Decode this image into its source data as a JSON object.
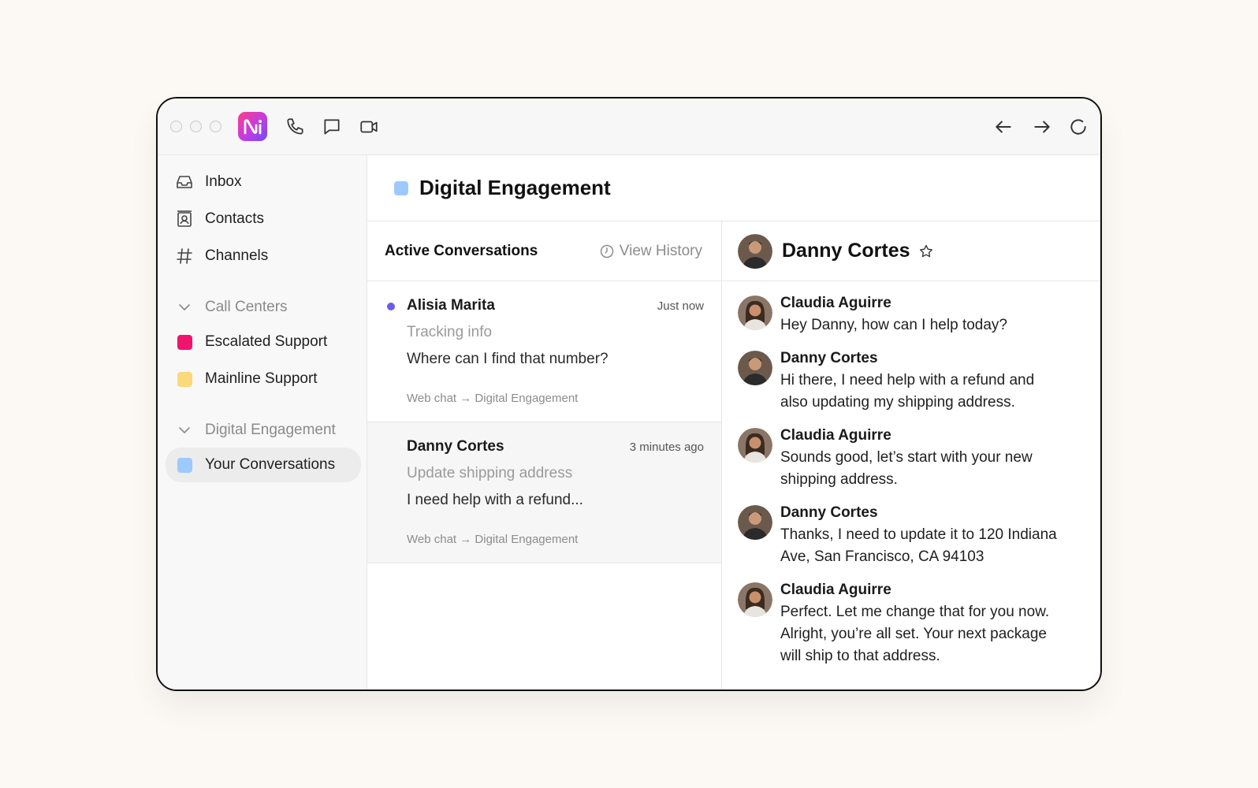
{
  "app": {
    "title": "Digital Engagement",
    "brand_color": "#c03de0"
  },
  "titlebar": {
    "icons": [
      "phone-icon",
      "chat-bubble-icon",
      "video-icon",
      "arrow-left-icon",
      "arrow-right-icon",
      "refresh-icon"
    ]
  },
  "sidebar": {
    "items": [
      {
        "label": "Inbox",
        "icon": "inbox-icon"
      },
      {
        "label": "Contacts",
        "icon": "contacts-icon"
      },
      {
        "label": "Channels",
        "icon": "hash-icon"
      }
    ],
    "sections": [
      {
        "label": "Call Centers",
        "items": [
          {
            "label": "Escalated Support",
            "color": "#f0146e"
          },
          {
            "label": "Mainline Support",
            "color": "#fbd97a"
          }
        ]
      },
      {
        "label": "Digital Engagement",
        "items": [
          {
            "label": "Your Conversations",
            "color": "#9ec9ff"
          }
        ]
      }
    ]
  },
  "main": {
    "title": "Digital Engagement",
    "color": "#9ec9ff"
  },
  "list": {
    "title": "Active Conversations",
    "history_label": "View History",
    "conversations": [
      {
        "name": "Alisia Marita",
        "time": "Just now",
        "subject": "Tracking info",
        "preview": "Where can I find that number?",
        "route": "Web chat → Digital Engagement",
        "unread": true
      },
      {
        "name": "Danny Cortes",
        "time": "3 minutes ago",
        "subject": "Update shipping address",
        "preview": "I need help with a refund...",
        "route": "Web chat → Digital Engagement",
        "unread": false
      }
    ]
  },
  "chat": {
    "contact": "Danny Cortes",
    "messages": [
      {
        "sender": "Claudia Aguirre",
        "text": "Hey Danny, how can I help today?"
      },
      {
        "sender": "Danny Cortes",
        "text": "Hi there, I need help with a refund and also updating my shipping address."
      },
      {
        "sender": "Claudia Aguirre",
        "text": "Sounds good, let’s start with your new shipping address."
      },
      {
        "sender": "Danny Cortes",
        "text": "Thanks, I need to update it to 120 Indiana Ave, San Francisco, CA 94103"
      },
      {
        "sender": "Claudia Aguirre",
        "text": "Perfect. Let me change that for you now. Alright, you’re all set. Your next package will ship to that address."
      }
    ]
  }
}
